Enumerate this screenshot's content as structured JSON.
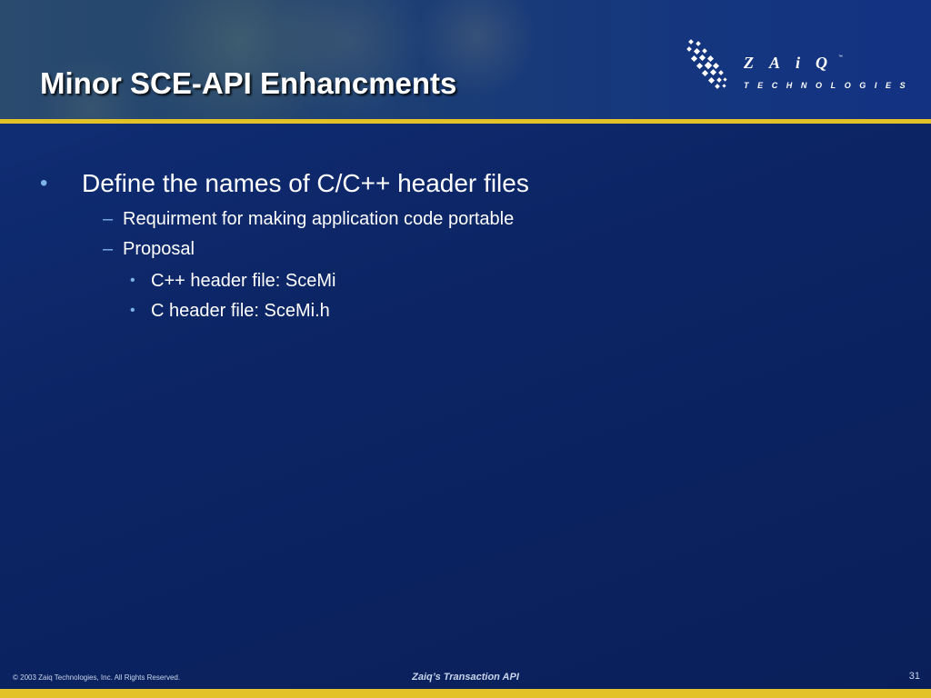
{
  "slide": {
    "title": "Minor SCE-API Enhancments",
    "logo": {
      "wordmark": "ZAiQ",
      "tm": "™",
      "tagline": "TECHNOLOGIES"
    },
    "bullets": [
      {
        "mark": "•",
        "text": "Define the names of C/C++ header files",
        "children": [
          {
            "mark": "–",
            "text": "Requirment for making application code portable"
          },
          {
            "mark": "–",
            "text": "Proposal",
            "children": [
              {
                "mark": "•",
                "text": "C++ header file: SceMi"
              },
              {
                "mark": "•",
                "text": "C header file: SceMi.h"
              }
            ]
          }
        ]
      }
    ],
    "footer": {
      "copyright": "© 2003 Zaiq Technologies, Inc.  All Rights Reserved.",
      "center": "Zaiq’s Transaction API",
      "page_number": "31"
    },
    "colors": {
      "background": "#0c2160",
      "accent_rule": "#e3c229",
      "bullet": "#7fb4e6",
      "text": "#ffffff"
    }
  }
}
